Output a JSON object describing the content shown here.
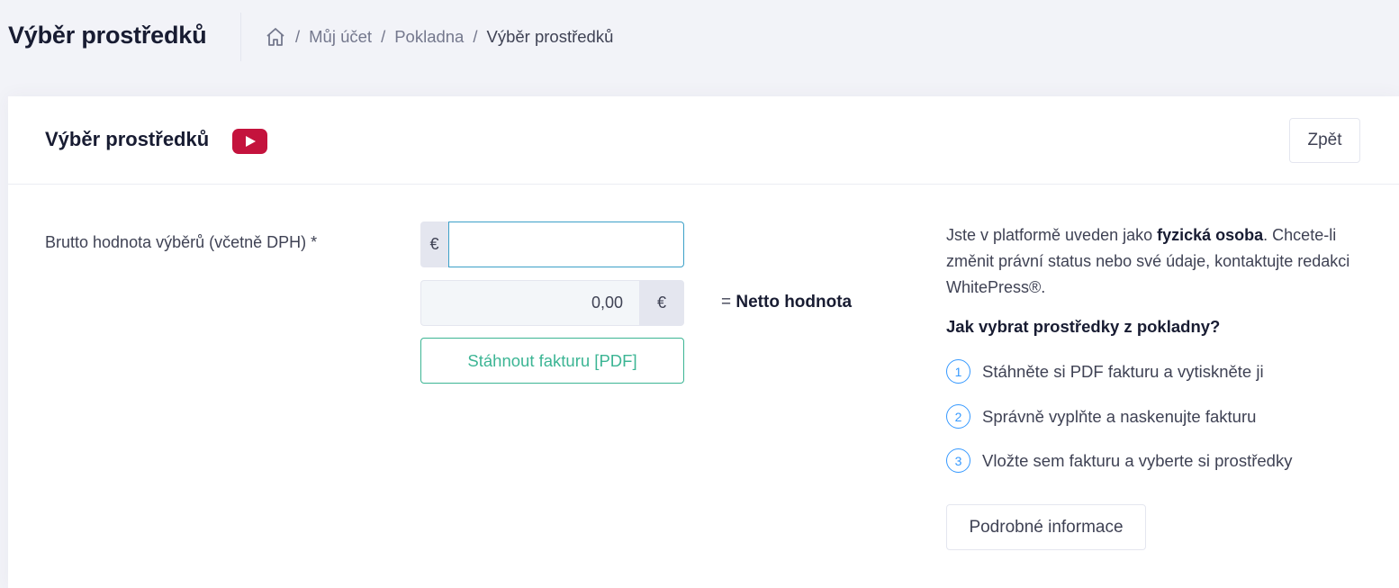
{
  "header": {
    "title": "Výběr prostředků",
    "breadcrumb": [
      {
        "label": "Můj účet"
      },
      {
        "label": "Pokladna"
      },
      {
        "label": "Výběr prostředků"
      }
    ],
    "separator": "/"
  },
  "card": {
    "title": "Výběr prostředků",
    "back_label": "Zpět",
    "youtube_icon": "youtube-play-icon"
  },
  "form": {
    "gross_label": "Brutto hodnota výběrů (včetně DPH) *",
    "gross_currency": "€",
    "gross_value": "",
    "net_value": "0,00",
    "net_currency": "€",
    "net_label_prefix": "= ",
    "net_label": "Netto hodnota",
    "invoice_button": "Stáhnout fakturu [PDF]"
  },
  "info": {
    "text_before": "Jste v platformě uveden jako ",
    "status": "fyzická osoba",
    "text_after": ". Chcete-li změnit právní status nebo své údaje, kontaktujte redakci WhitePress®.",
    "heading": "Jak vybrat prostředky z pokladny?",
    "steps": [
      {
        "num": "1",
        "text": "Stáhněte si PDF fakturu a vytiskněte ji"
      },
      {
        "num": "2",
        "text": "Správně vyplňte a naskenujte fakturu"
      },
      {
        "num": "3",
        "text": "Vložte sem fakturu a vyberte si prostředky"
      }
    ],
    "more_button": "Podrobné informace"
  },
  "colors": {
    "accent_green": "#3cb594",
    "accent_blue": "#3699ff",
    "youtube_red": "#c4133d"
  }
}
